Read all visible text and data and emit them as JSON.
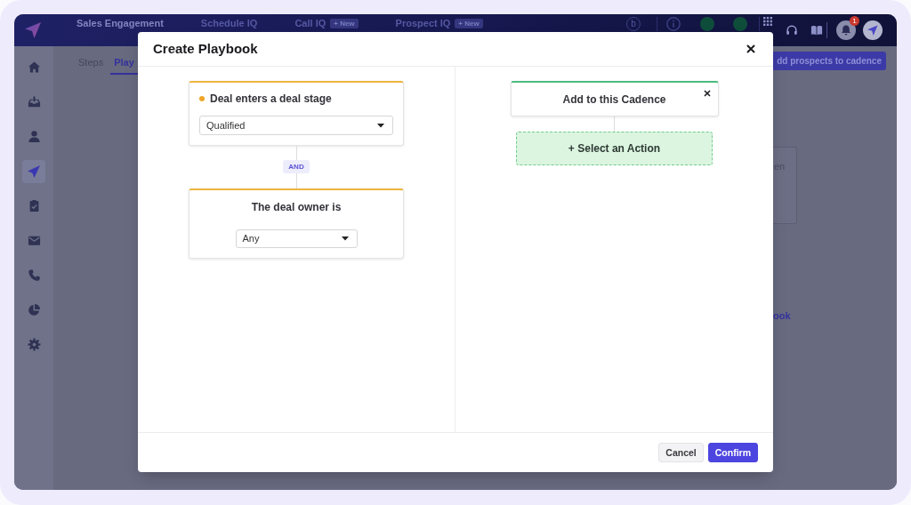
{
  "navbar": {
    "tabs": [
      {
        "label": "Sales Engagement",
        "selected": true
      },
      {
        "label": "Schedule IQ",
        "selected": false
      },
      {
        "label": "Call IQ",
        "selected": false,
        "badge": "+ New"
      },
      {
        "label": "Prospect IQ",
        "selected": false,
        "badge": "+ New"
      }
    ],
    "avatar_initial": "b",
    "notification_count": "1"
  },
  "sidebar": {
    "items": [
      {
        "selected": false
      },
      {
        "selected": false
      },
      {
        "selected": false
      },
      {
        "selected": true
      },
      {
        "selected": false
      },
      {
        "selected": false
      },
      {
        "selected": false
      },
      {
        "selected": false
      },
      {
        "selected": false
      }
    ]
  },
  "page": {
    "tabs": [
      {
        "label": "Steps",
        "selected": false
      },
      {
        "label": "Play",
        "selected": true
      }
    ],
    "add_button": "dd prospects to cadence",
    "card_text": "en",
    "link": "ook"
  },
  "modal": {
    "title": "Create Playbook",
    "conditions": [
      {
        "kind": "trigger",
        "title": "Deal enters a deal stage",
        "value": "Qualified"
      },
      {
        "kind": "filter",
        "title": "The deal owner is",
        "value": "Any"
      }
    ],
    "joiner": "AND",
    "action_card": {
      "title": "Add to this Cadence"
    },
    "add_action": "+ Select an Action",
    "buttons": [
      {
        "label": "Cancel",
        "kind": "secondary"
      },
      {
        "label": "Confirm",
        "kind": "primary"
      }
    ]
  }
}
